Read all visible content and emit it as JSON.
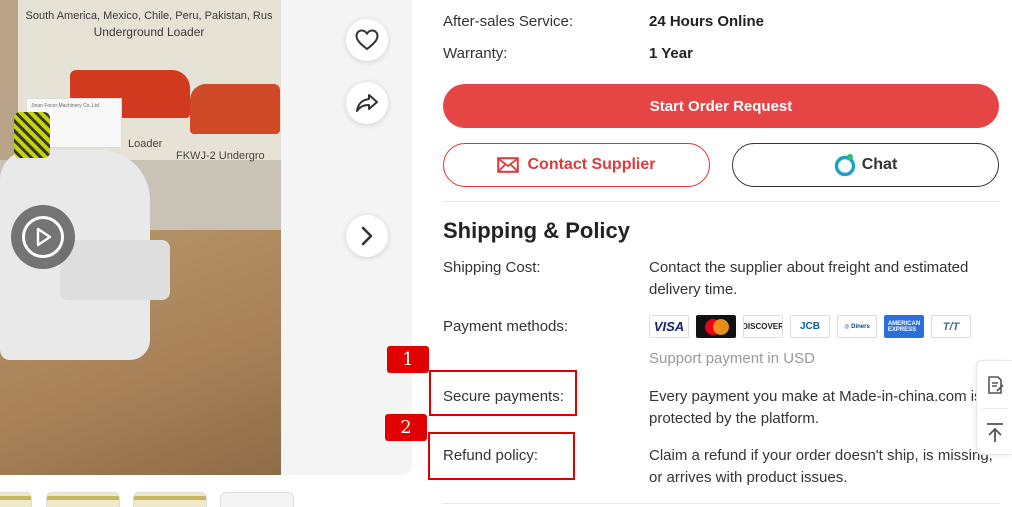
{
  "gallery": {
    "poster_caption_line1": "South America, Mexico, Chile, Peru, Pakistan, Rus",
    "poster_caption_line2": "Underground Loader",
    "poster_loader_label": "Loader",
    "poster_model_label": "FKWJ-2 Undergro",
    "card_text": "Jinan Focor Machinery Co.,Ltd"
  },
  "specs": [
    {
      "label": "After-sales Service:",
      "value": "24 Hours Online"
    },
    {
      "label": "Warranty:",
      "value": "1 Year"
    }
  ],
  "actions": {
    "order_label": "Start Order Request",
    "contact_label": "Contact Supplier",
    "chat_label": "Chat"
  },
  "shipping": {
    "title": "Shipping & Policy",
    "shipping_cost_label": "Shipping Cost:",
    "shipping_cost_value": "Contact the supplier about freight and estimated delivery time.",
    "payment_methods_label": "Payment methods:",
    "payment_icons": [
      "VISA",
      "mastercard",
      "DISCOVER",
      "JCB",
      "Diners Club International",
      "AMERICAN EXPRESS",
      "T/T"
    ],
    "payment_note": "Support payment in USD",
    "secure_label": "Secure payments:",
    "secure_value": "Every payment you make at Made-in-china.com is protected by the platform.",
    "refund_label": "Refund policy:",
    "refund_value": "Claim a refund if your order doesn't ship, is missing, or arrives with product issues."
  },
  "markers": [
    "1",
    "2"
  ],
  "colors": {
    "accent": "#e64545",
    "marker": "#e00000"
  }
}
